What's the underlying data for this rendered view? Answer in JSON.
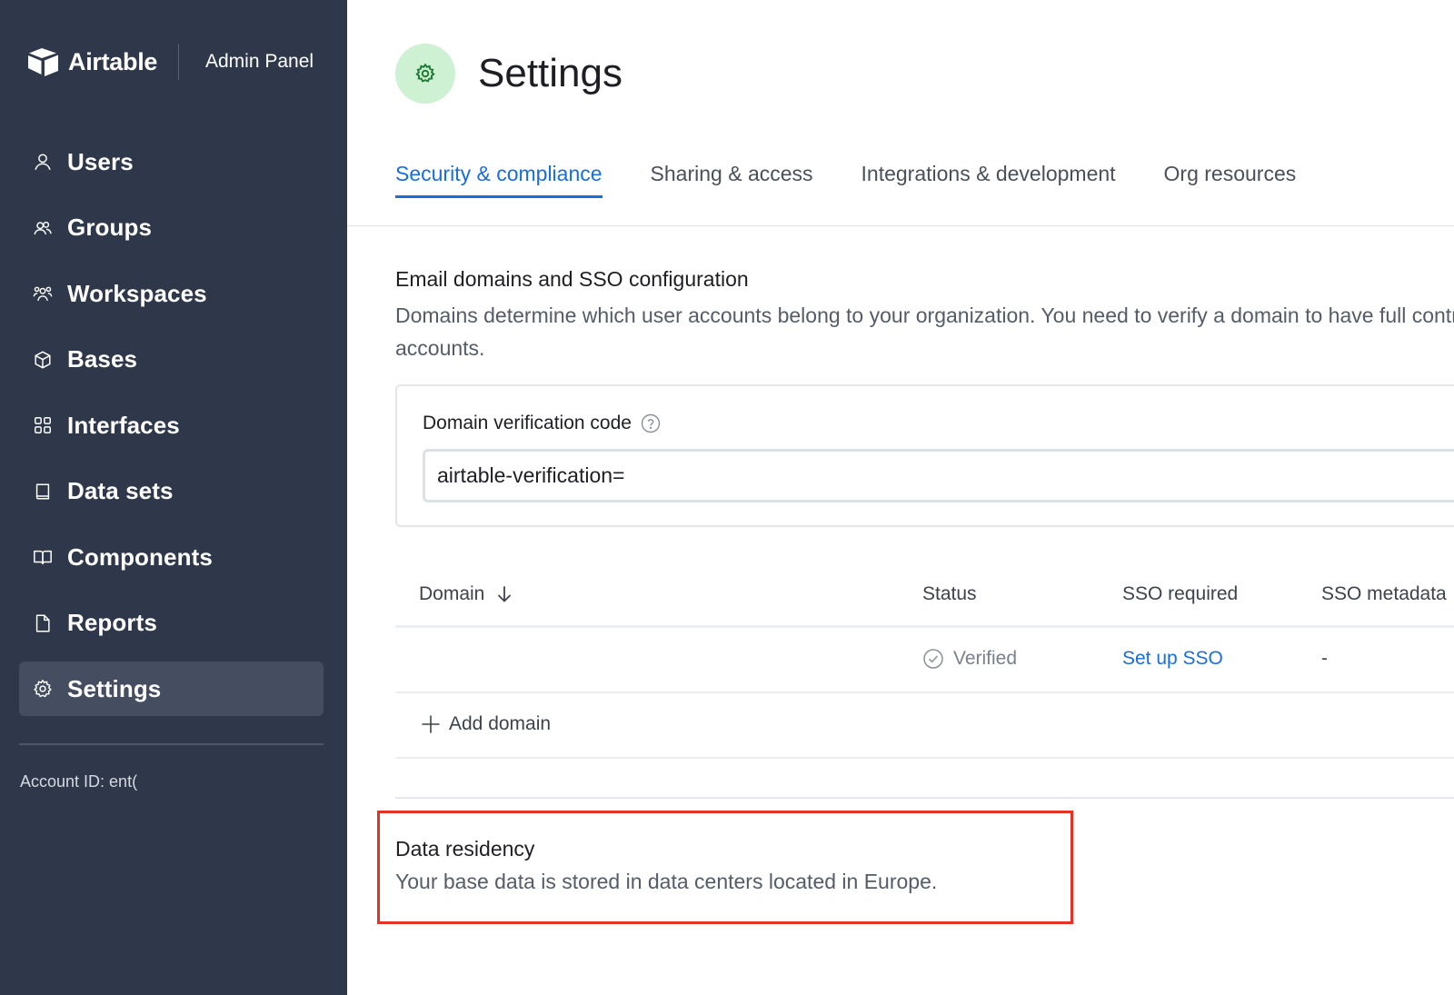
{
  "brand": {
    "name": "Airtable",
    "subtitle": "Admin Panel"
  },
  "sidebar": {
    "items": [
      {
        "label": "Users",
        "icon": "user-icon",
        "active": false
      },
      {
        "label": "Groups",
        "icon": "group-icon",
        "active": false
      },
      {
        "label": "Workspaces",
        "icon": "workspaces-icon",
        "active": false
      },
      {
        "label": "Bases",
        "icon": "cube-icon",
        "active": false
      },
      {
        "label": "Interfaces",
        "icon": "grid-icon",
        "active": false
      },
      {
        "label": "Data sets",
        "icon": "book-icon",
        "active": false
      },
      {
        "label": "Components",
        "icon": "open-book-icon",
        "active": false
      },
      {
        "label": "Reports",
        "icon": "file-icon",
        "active": false
      },
      {
        "label": "Settings",
        "icon": "gear-icon",
        "active": true
      }
    ],
    "account_id": "Account ID: ent("
  },
  "page": {
    "title": "Settings",
    "icon": "gear-icon",
    "icon_bg": "#cdf1d2",
    "accent": "#166ee1"
  },
  "tabs": [
    {
      "label": "Security & compliance",
      "active": true
    },
    {
      "label": "Sharing & access",
      "active": false
    },
    {
      "label": "Integrations & development",
      "active": false
    },
    {
      "label": "Org resources",
      "active": false
    }
  ],
  "email_section": {
    "title": "Email domains and SSO configuration",
    "description": "Domains determine which user accounts belong to your organization. You need to verify a domain to have full control over user accounts.",
    "verification": {
      "label": "Domain verification code",
      "value": "airtable-verification="
    }
  },
  "domain_table": {
    "headers": {
      "domain": "Domain",
      "status": "Status",
      "sso_required": "SSO required",
      "sso_metadata": "SSO metadata"
    },
    "rows": [
      {
        "domain": "",
        "status": "Verified",
        "sso_required": "Set up SSO",
        "sso_metadata": "-"
      }
    ],
    "add_label": "Add domain"
  },
  "data_residency": {
    "title": "Data residency",
    "description": "Your base data is stored in data centers located in Europe.",
    "highlight_color": "#e53224"
  }
}
